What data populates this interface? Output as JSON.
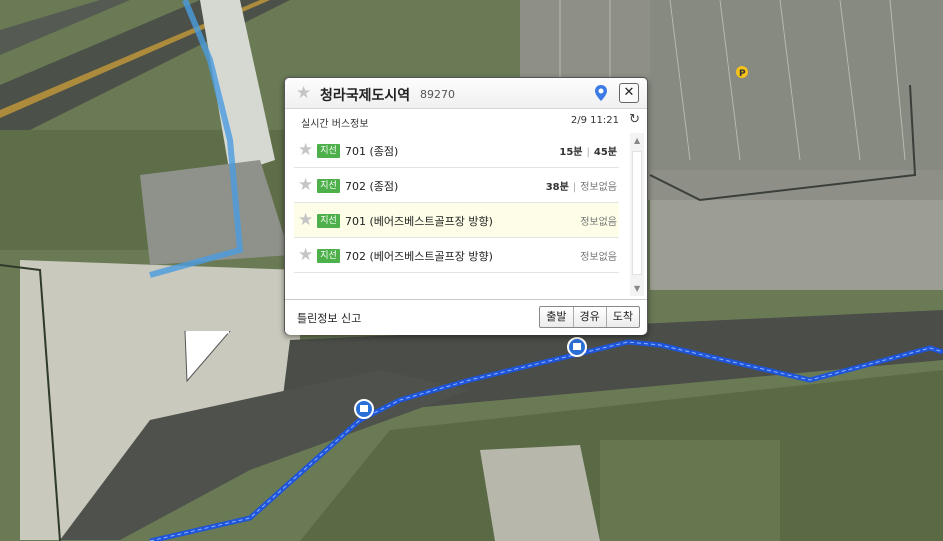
{
  "popup": {
    "title": "청라국제도시역",
    "stop_id": "89270",
    "subtitle": "실시간 버스정보",
    "timestamp": "2/9 11:21",
    "close_label": "✕",
    "routes": [
      {
        "badge": "지선",
        "name": "701 (종점)",
        "time1": "15분",
        "time2": "45분"
      },
      {
        "badge": "지선",
        "name": "702 (종점)",
        "time1": "38분",
        "time2": "정보없음"
      },
      {
        "badge": "지선",
        "name": "701 (베어즈베스트골프장 방향)",
        "time1": "",
        "time2": "정보없음"
      },
      {
        "badge": "지선",
        "name": "702 (베어즈베스트골프장 방향)",
        "time1": "",
        "time2": "정보없음"
      }
    ],
    "report_label": "틀린정보 신고",
    "buttons": {
      "depart": "출발",
      "via": "경유",
      "arrive": "도착"
    }
  },
  "map": {
    "parking_label": "P",
    "route_color": "#2f6fe6",
    "highlight_row_color": "#fdfde8",
    "badge_color": "#4db04a"
  }
}
